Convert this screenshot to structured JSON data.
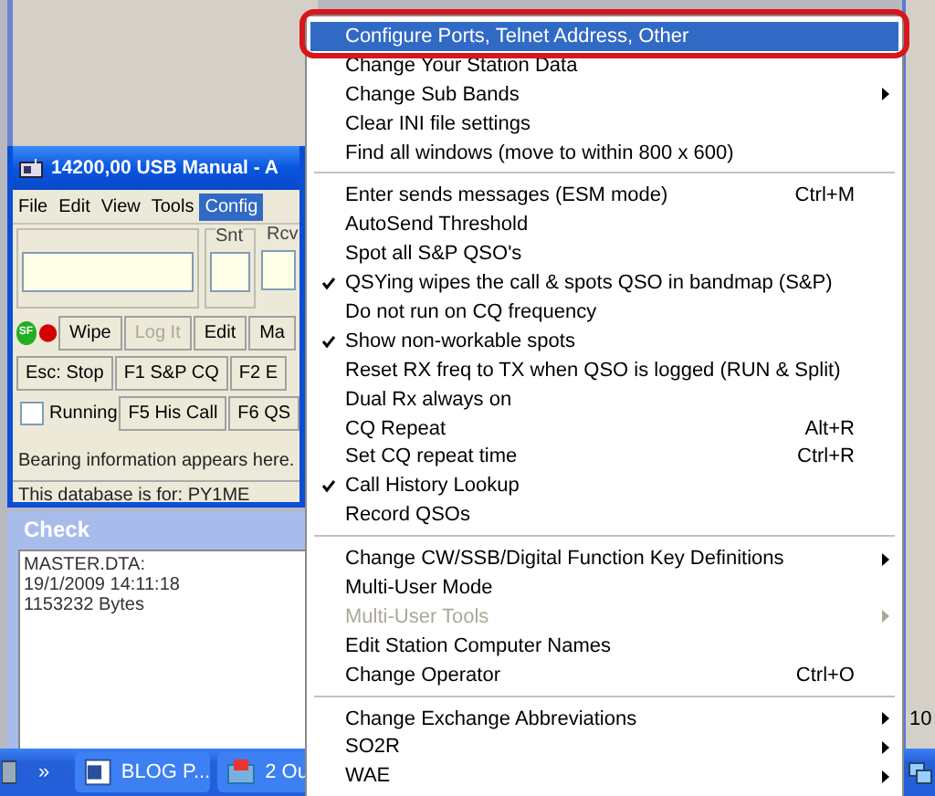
{
  "main_window": {
    "title": "14200,00 USB Manual - A",
    "menu": [
      {
        "label": "File",
        "selected": false
      },
      {
        "label": "Edit",
        "selected": false
      },
      {
        "label": "View",
        "selected": false
      },
      {
        "label": "Tools",
        "selected": false
      },
      {
        "label": "Config",
        "selected": true
      }
    ],
    "snt_label": "Snt",
    "rcv_label": "Rcv",
    "status_badge": "SF",
    "button_rows": [
      [
        {
          "label": "Wipe",
          "disabled": false
        },
        {
          "label": "Log It",
          "disabled": true
        },
        {
          "label": "Edit",
          "disabled": false
        },
        {
          "label": "Ma",
          "disabled": false
        }
      ],
      [
        {
          "label": "Esc: Stop",
          "disabled": false
        },
        {
          "label": "F1 S&P CQ",
          "disabled": false
        },
        {
          "label": "F2 E",
          "disabled": false
        }
      ],
      [
        {
          "label": "F5 His Call",
          "disabled": false
        },
        {
          "label": "F6 QS",
          "disabled": false
        }
      ]
    ],
    "running": {
      "label": "Running",
      "checked": false
    },
    "info_text": "Bearing information appears here.",
    "status_bar": "This database is for: PY1ME"
  },
  "check_window": {
    "title": "Check",
    "lines": [
      "MASTER.DTA:",
      "19/1/2009 14:11:18",
      "1153232 Bytes"
    ]
  },
  "context_menu": {
    "items": [
      {
        "kind": "item",
        "label": "Configure Ports, Telnet Address, Other",
        "checked": false,
        "submenu": false,
        "disabled": false,
        "selected": true
      },
      {
        "kind": "item",
        "label": "Change Your Station Data",
        "checked": false,
        "submenu": false,
        "disabled": false,
        "selected": false
      },
      {
        "kind": "item",
        "label": "Change Sub Bands",
        "checked": false,
        "submenu": true,
        "disabled": false,
        "selected": false
      },
      {
        "kind": "item",
        "label": "Clear INI file settings",
        "checked": false,
        "submenu": false,
        "disabled": false,
        "selected": false
      },
      {
        "kind": "item",
        "label": "Find all windows (move to within 800 x 600)",
        "checked": false,
        "submenu": false,
        "disabled": false,
        "selected": false
      },
      {
        "kind": "separator"
      },
      {
        "kind": "item",
        "label": "Enter sends messages (ESM mode)",
        "shortcut": "Ctrl+M",
        "checked": false,
        "submenu": false,
        "disabled": false,
        "selected": false
      },
      {
        "kind": "item",
        "label": "AutoSend Threshold",
        "checked": false,
        "submenu": false,
        "disabled": false,
        "selected": false
      },
      {
        "kind": "item",
        "label": "Spot all S&P QSO's",
        "checked": false,
        "submenu": false,
        "disabled": false,
        "selected": false
      },
      {
        "kind": "item",
        "label": "QSYing wipes the call & spots QSO in bandmap (S&P)",
        "checked": true,
        "submenu": false,
        "disabled": false,
        "selected": false
      },
      {
        "kind": "item",
        "label": "Do not run on CQ frequency",
        "checked": false,
        "submenu": false,
        "disabled": false,
        "selected": false
      },
      {
        "kind": "item",
        "label": "Show non-workable spots",
        "checked": true,
        "submenu": false,
        "disabled": false,
        "selected": false
      },
      {
        "kind": "item",
        "label": "Reset RX freq to TX when QSO is logged (RUN & Split)",
        "checked": false,
        "submenu": false,
        "disabled": false,
        "selected": false
      },
      {
        "kind": "item",
        "label": "Dual Rx always on",
        "checked": false,
        "submenu": false,
        "disabled": false,
        "selected": false
      },
      {
        "kind": "item",
        "label": "CQ Repeat",
        "shortcut": "Alt+R",
        "checked": false,
        "submenu": false,
        "disabled": false,
        "selected": false
      },
      {
        "kind": "item",
        "label": "Set CQ repeat time",
        "shortcut": "Ctrl+R",
        "checked": false,
        "submenu": false,
        "disabled": false,
        "selected": false
      },
      {
        "kind": "item",
        "label": "Call History Lookup",
        "checked": true,
        "submenu": false,
        "disabled": false,
        "selected": false
      },
      {
        "kind": "item",
        "label": "Record QSOs",
        "checked": false,
        "submenu": false,
        "disabled": false,
        "selected": false
      },
      {
        "kind": "separator"
      },
      {
        "kind": "item",
        "label": "Change CW/SSB/Digital Function Key Definitions",
        "checked": false,
        "submenu": true,
        "disabled": false,
        "selected": false
      },
      {
        "kind": "item",
        "label": "Multi-User Mode",
        "checked": false,
        "submenu": false,
        "disabled": false,
        "selected": false
      },
      {
        "kind": "item",
        "label": "Multi-User Tools",
        "checked": false,
        "submenu": true,
        "disabled": true,
        "selected": false
      },
      {
        "kind": "item",
        "label": "Edit Station Computer Names",
        "checked": false,
        "submenu": false,
        "disabled": false,
        "selected": false
      },
      {
        "kind": "item",
        "label": "Change Operator",
        "shortcut": "Ctrl+O",
        "checked": false,
        "submenu": false,
        "disabled": false,
        "selected": false
      },
      {
        "kind": "separator"
      },
      {
        "kind": "item",
        "label": "Change Exchange Abbreviations",
        "checked": false,
        "submenu": true,
        "disabled": false,
        "selected": false
      },
      {
        "kind": "item",
        "label": "SO2R",
        "checked": false,
        "submenu": true,
        "disabled": false,
        "selected": false
      },
      {
        "kind": "item",
        "label": "WAE",
        "checked": false,
        "submenu": true,
        "disabled": false,
        "selected": false
      }
    ]
  },
  "taskbar": {
    "chevron": "»",
    "buttons": [
      {
        "label": "BLOG P..."
      },
      {
        "label": "2 Ou"
      }
    ]
  },
  "background_window": {
    "text": "10"
  }
}
